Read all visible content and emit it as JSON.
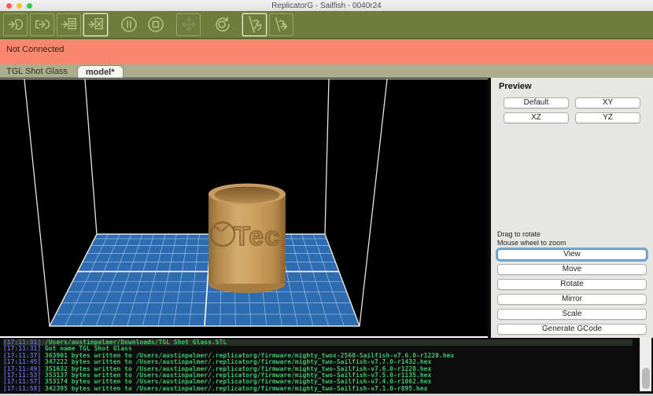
{
  "window": {
    "title": "ReplicatorG - Sailfish - 0040r24"
  },
  "toolbar": {
    "background": "#6e7d3d",
    "icons": [
      "connect",
      "build",
      "build-from-file",
      "build-to-file",
      "pause",
      "stop",
      "control-panel",
      "reset",
      "disconnect",
      "upload-firmware"
    ],
    "active_icons": [
      "build-to-file",
      "disconnect"
    ],
    "disabled_icons": [
      "control-panel"
    ]
  },
  "status": {
    "message": "Not Connected",
    "background": "#f9876e"
  },
  "tabs": {
    "inactive": "TGL Shot Glass",
    "active": "model*"
  },
  "viewport": {
    "model_emboss": "Tec",
    "platform_color": "#2e6cb2",
    "grid_line_color": "#9dbfe6",
    "model_color": "#c99d60"
  },
  "preview": {
    "title": "Preview",
    "view_buttons": [
      "Default",
      "XY",
      "XZ",
      "YZ"
    ],
    "hints": [
      "Drag to rotate",
      "Mouse wheel to zoom"
    ],
    "action_buttons": [
      "View",
      "Move",
      "Rotate",
      "Mirror",
      "Scale",
      "Generate GCode"
    ],
    "focused_button": "View"
  },
  "console": {
    "lines": [
      {
        "time": "[17:11:31]",
        "text": "/Users/austinpalmer/Downloads/TGL Shot Glass.STL"
      },
      {
        "time": "[17:11:31]",
        "text": "Got name TGL Shot Glass"
      },
      {
        "time": "[17:11:37]",
        "text": "363901 bytes written to /Users/austinpalmer/.replicatorg/firmware/mighty_twox-2560-Sailfish-v7.6.0-r1220.hex"
      },
      {
        "time": "[17:11:45]",
        "text": "347222 bytes written to /Users/austinpalmer/.replicatorg/firmware/mighty_two-Sailfish-v7.7.0-r1432.hex"
      },
      {
        "time": "[17:11:49]",
        "text": "351632 bytes written to /Users/austinpalmer/.replicatorg/firmware/mighty_two-Sailfish-v7.6.0-r1220.hex"
      },
      {
        "time": "[17:11:53]",
        "text": "353137 bytes written to /Users/austinpalmer/.replicatorg/firmware/mighty_two-Sailfish-v7.5.0-r1135.hex"
      },
      {
        "time": "[17:11:57]",
        "text": "353174 bytes written to /Users/austinpalmer/.replicatorg/firmware/mighty_two-Sailfish-v7.4.0-r1062.hex"
      },
      {
        "time": "[17:11:58]",
        "text": "342395 bytes written to /Users/austinpalmer/.replicatorg/firmware/mighty_two-Sailfish-v7.1.0-r895.hex"
      }
    ]
  }
}
